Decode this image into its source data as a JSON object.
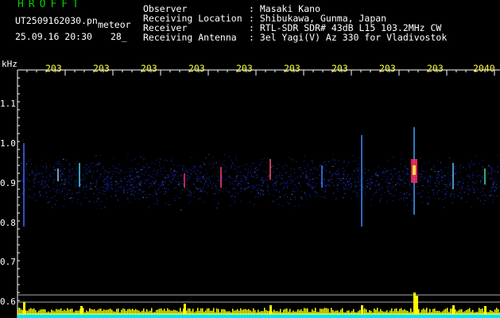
{
  "header": {
    "app_logo": "HROFFT",
    "file_name": "UT2509162030.pn",
    "detection_label": "meteor",
    "date_time": "25.09.16 20:30",
    "count": "28_",
    "info": [
      {
        "key": "Observer",
        "value": ": Masaki Kano"
      },
      {
        "key": "Receiving Location",
        "value": ": Shibukawa, Gunma, Japan"
      },
      {
        "key": "Receiver",
        "value": ": RTL-SDR SDR# 43dB L15 103.2MHz CW"
      },
      {
        "key": "Receiving Antenna",
        "value": ": 3el Yagi(V) Az 330 for Vladivostok"
      }
    ]
  },
  "plot": {
    "y_unit": "kHz",
    "y_ticks": [
      "1.1",
      "1.0",
      "0.9",
      "0.8",
      "0.7",
      "0.6"
    ],
    "time_ticks": [
      "203",
      "203",
      "203",
      "203",
      "203",
      "203",
      "203",
      "203",
      "203",
      "2040"
    ],
    "colors": {
      "background": "#000000",
      "noise": "#1a2fd0",
      "tick_text": "#ffff40",
      "amplitude": "#ffff00",
      "baseline": "#00e5ff"
    }
  }
}
